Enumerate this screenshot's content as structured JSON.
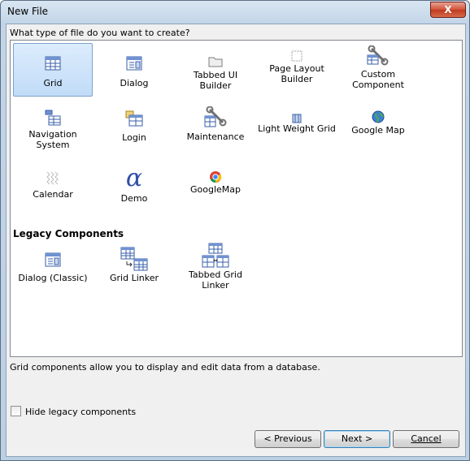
{
  "window": {
    "title": "New File",
    "close_label": "X"
  },
  "prompt": "What type of file do you want to create?",
  "items": [
    {
      "label": "Grid",
      "icon": "grid-icon"
    },
    {
      "label": "Dialog",
      "icon": "dialog-icon"
    },
    {
      "label": "Tabbed UI Builder",
      "icon": "folder-icon"
    },
    {
      "label": "Page Layout Builder",
      "icon": "dotted-page-icon"
    },
    {
      "label": "Custom Component",
      "icon": "wrench-grid-icon"
    },
    {
      "label": "Navigation System",
      "icon": "navigation-icon"
    },
    {
      "label": "Login",
      "icon": "login-icon"
    },
    {
      "label": "Maintenance",
      "icon": "maintenance-icon"
    },
    {
      "label": "Light Weight Grid",
      "icon": "light-grid-icon"
    },
    {
      "label": "Google Map",
      "icon": "globe-icon"
    },
    {
      "label": "Calendar",
      "icon": "calendar-icon"
    },
    {
      "label": "Demo",
      "icon": "alpha-icon"
    },
    {
      "label": "GoogleMap",
      "icon": "chrome-icon"
    }
  ],
  "legacy": {
    "heading": "Legacy Components",
    "items": [
      {
        "label": "Dialog (Classic)",
        "icon": "dialog-classic-icon"
      },
      {
        "label": "Grid Linker",
        "icon": "grid-linker-icon"
      },
      {
        "label": "Tabbed Grid Linker",
        "icon": "tabbed-grid-linker-icon"
      }
    ]
  },
  "description": "Grid components allow you to display and edit data from a database.",
  "hide_legacy": {
    "label": "Hide legacy components",
    "checked": false
  },
  "buttons": {
    "previous": "< Previous",
    "next": "Next >",
    "cancel": "Cancel"
  },
  "colors": {
    "selection": "#c1dcf8",
    "accent": "#3c7fb1"
  }
}
